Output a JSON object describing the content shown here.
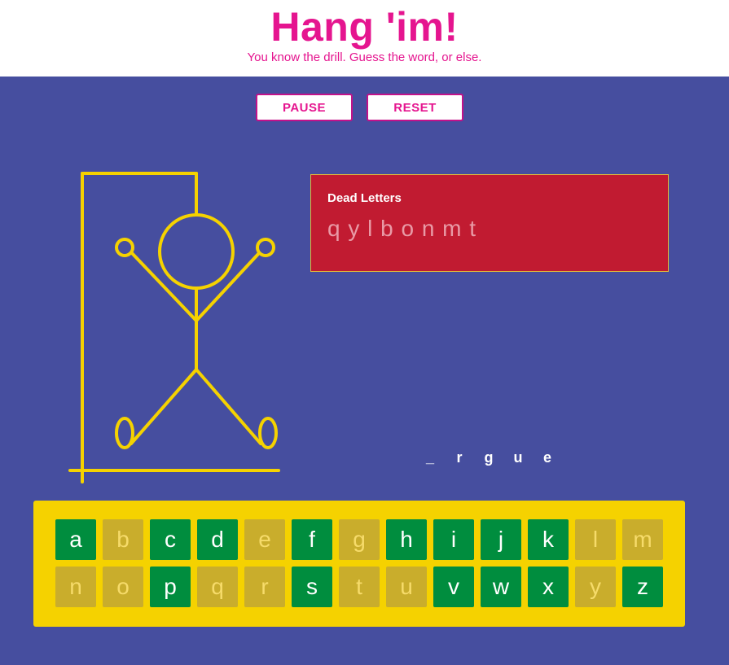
{
  "header": {
    "title": "Hang 'im!",
    "subtitle": "You know the drill. Guess the word, or else."
  },
  "controls": {
    "pause_label": "PAUSE",
    "reset_label": "RESET"
  },
  "dead_letters": {
    "title": "Dead Letters",
    "letters": "q y l b o n m t"
  },
  "word": [
    "_",
    "r",
    "g",
    "u",
    "e"
  ],
  "keyboard": {
    "rows": [
      [
        {
          "letter": "a",
          "used": false
        },
        {
          "letter": "b",
          "used": true
        },
        {
          "letter": "c",
          "used": false
        },
        {
          "letter": "d",
          "used": false
        },
        {
          "letter": "e",
          "used": true
        },
        {
          "letter": "f",
          "used": false
        },
        {
          "letter": "g",
          "used": true
        },
        {
          "letter": "h",
          "used": false
        },
        {
          "letter": "i",
          "used": false
        },
        {
          "letter": "j",
          "used": false
        },
        {
          "letter": "k",
          "used": false
        },
        {
          "letter": "l",
          "used": true
        },
        {
          "letter": "m",
          "used": true
        }
      ],
      [
        {
          "letter": "n",
          "used": true
        },
        {
          "letter": "o",
          "used": true
        },
        {
          "letter": "p",
          "used": false
        },
        {
          "letter": "q",
          "used": true
        },
        {
          "letter": "r",
          "used": true
        },
        {
          "letter": "s",
          "used": false
        },
        {
          "letter": "t",
          "used": true
        },
        {
          "letter": "u",
          "used": true
        },
        {
          "letter": "v",
          "used": false
        },
        {
          "letter": "w",
          "used": false
        },
        {
          "letter": "x",
          "used": false
        },
        {
          "letter": "y",
          "used": true
        },
        {
          "letter": "z",
          "used": false
        }
      ]
    ]
  },
  "colors": {
    "brand_pink": "#e5158f",
    "stage_blue": "#464e9f",
    "drawing_yellow": "#f5d200",
    "dead_red": "#c11b31",
    "key_green": "#008d3e",
    "key_used": "#c9ad2c"
  }
}
